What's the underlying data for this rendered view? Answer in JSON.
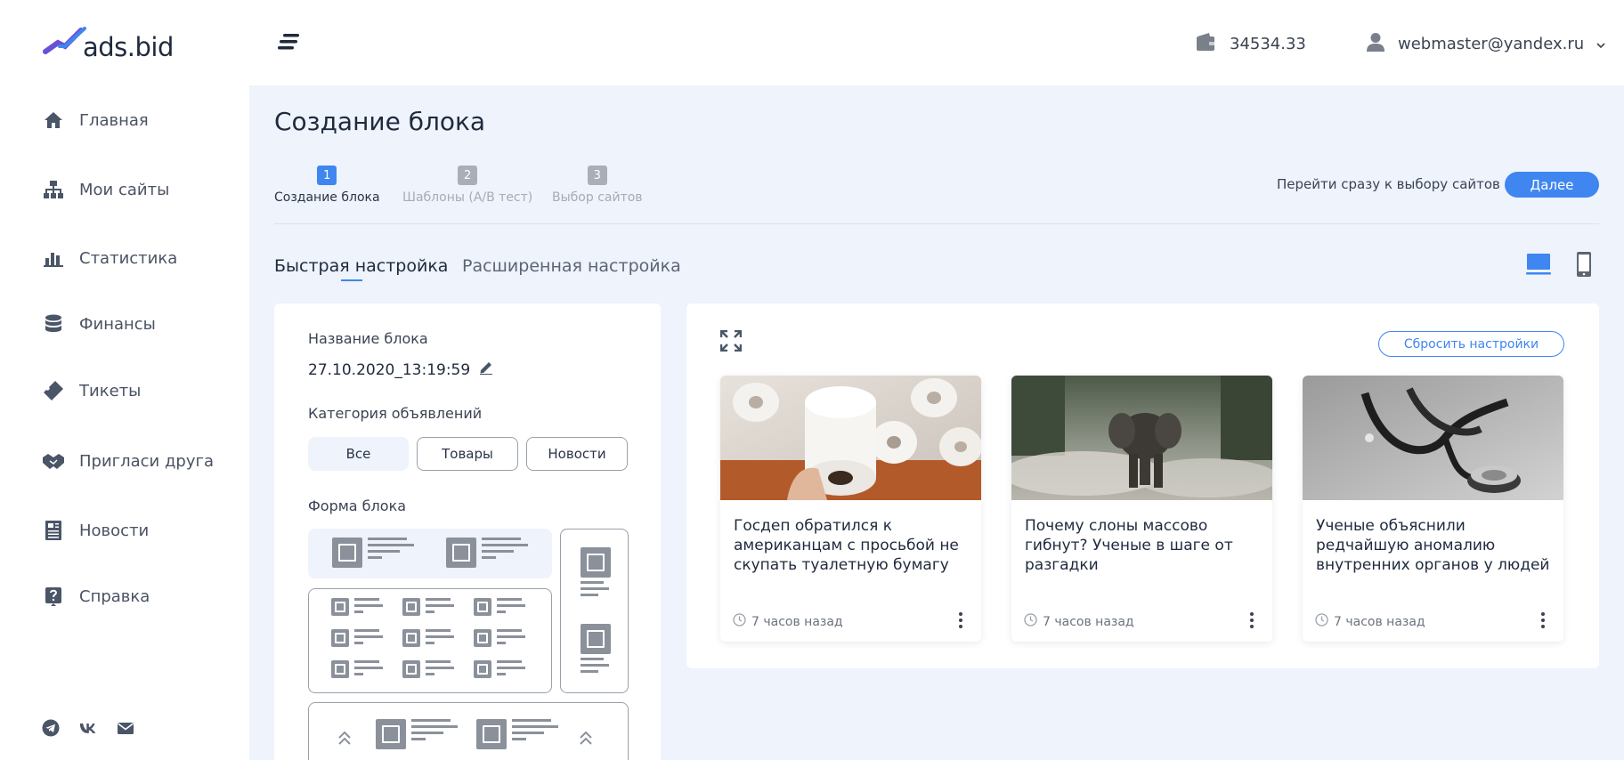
{
  "logo": {
    "text": "ads.bid"
  },
  "sidebar": {
    "items": [
      {
        "label": "Главная",
        "icon": "home-icon"
      },
      {
        "label": "Мои сайты",
        "icon": "sitemap-icon"
      },
      {
        "label": "Статистика",
        "icon": "bar-chart-icon"
      },
      {
        "label": "Финансы",
        "icon": "database-icon"
      },
      {
        "label": "Тикеты",
        "icon": "ticket-icon"
      },
      {
        "label": "Пригласи друга",
        "icon": "handshake-icon"
      },
      {
        "label": "Новости",
        "icon": "newspaper-icon"
      },
      {
        "label": "Справка",
        "icon": "help-icon"
      }
    ],
    "social": [
      "telegram-icon",
      "vk-icon",
      "mail-icon"
    ]
  },
  "header": {
    "balance": "34534.33",
    "user_email": "webmaster@yandex.ru"
  },
  "page": {
    "title": "Создание блока",
    "steps": [
      {
        "num": "1",
        "label": "Создание блока",
        "active": true
      },
      {
        "num": "2",
        "label": "Шаблоны (A/B тест)",
        "active": false
      },
      {
        "num": "3",
        "label": "Выбор сайтов",
        "active": false
      }
    ],
    "skip_link": "Перейти сразу к выбору сайтов",
    "next_button": "Далее",
    "tabs": [
      "Быстрая настройка",
      "Расширенная настройка"
    ],
    "active_tab": "Быстрая настройка",
    "view_mode": "desktop"
  },
  "settings": {
    "name_label": "Название блока",
    "name_value": "27.10.2020_13:19:59",
    "category_label": "Категория объявлений",
    "categories": [
      "Все",
      "Товары",
      "Новости"
    ],
    "selected_category": "Все",
    "form_label": "Форма блока"
  },
  "preview": {
    "reset_button": "Сбросить настройки",
    "cards": [
      {
        "title": "Госдеп обратился к американцам с просьбой не скупать туалетную бумагу",
        "time": "7 часов назад",
        "image": "toilet-paper-photo"
      },
      {
        "title": "Почему слоны массово гибнут? Ученые в шаге от разгадки",
        "time": "7 часов назад",
        "image": "elephant-photo"
      },
      {
        "title": "Ученые объяснили редчайшую аномалию внутренних органов у людей",
        "time": "7 часов назад",
        "image": "stethoscope-photo"
      }
    ]
  },
  "colors": {
    "accent": "#3f86f0",
    "background": "#eef3fc",
    "text": "#1f2a3d",
    "muted": "#a6abb4"
  }
}
